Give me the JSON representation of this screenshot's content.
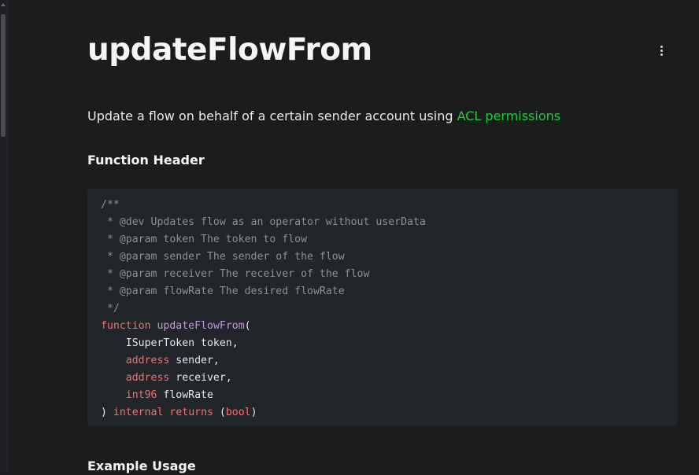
{
  "title": "updateFlowFrom",
  "intro": {
    "text": "Update a flow on behalf of a certain sender account using ",
    "link_label": "ACL permissions"
  },
  "sections": {
    "function_header": "Function Header",
    "example_usage": "Example Usage"
  },
  "colors": {
    "background": "#1b1c1e",
    "code_background": "#22252a",
    "link": "#1fcf3a",
    "comment": "#8c9097",
    "keyword": "#ff6b6b",
    "function_name": "#c792ea"
  },
  "icons": {
    "more_menu": "vertical-ellipsis-icon"
  },
  "code": {
    "lines": [
      [
        {
          "t": "/**",
          "k": "comment"
        }
      ],
      [
        {
          "t": " * @dev Updates flow as an operator without userData",
          "k": "comment"
        }
      ],
      [
        {
          "t": " * @param token The token to flow",
          "k": "comment"
        }
      ],
      [
        {
          "t": " * @param sender The sender of the flow",
          "k": "comment"
        }
      ],
      [
        {
          "t": " * @param receiver The receiver of the flow",
          "k": "comment"
        }
      ],
      [
        {
          "t": " * @param flowRate The desired flowRate",
          "k": "comment"
        }
      ],
      [
        {
          "t": " */",
          "k": "comment"
        }
      ],
      [
        {
          "t": "function",
          "k": "keyword"
        },
        {
          "t": " ",
          "k": "plain"
        },
        {
          "t": "updateFlowFrom",
          "k": "fn"
        },
        {
          "t": "(",
          "k": "plain"
        }
      ],
      [
        {
          "t": "    ISuperToken token,",
          "k": "plain"
        }
      ],
      [
        {
          "t": "    ",
          "k": "plain"
        },
        {
          "t": "address",
          "k": "keyword"
        },
        {
          "t": " sender,",
          "k": "plain"
        }
      ],
      [
        {
          "t": "    ",
          "k": "plain"
        },
        {
          "t": "address",
          "k": "keyword"
        },
        {
          "t": " receiver,",
          "k": "plain"
        }
      ],
      [
        {
          "t": "    ",
          "k": "plain"
        },
        {
          "t": "int96",
          "k": "keyword"
        },
        {
          "t": " flowRate",
          "k": "plain"
        }
      ],
      [
        {
          "t": ") ",
          "k": "plain"
        },
        {
          "t": "internal",
          "k": "keyword"
        },
        {
          "t": " ",
          "k": "plain"
        },
        {
          "t": "returns",
          "k": "keyword"
        },
        {
          "t": " (",
          "k": "plain"
        },
        {
          "t": "bool",
          "k": "keyword"
        },
        {
          "t": ")",
          "k": "plain"
        }
      ]
    ]
  }
}
